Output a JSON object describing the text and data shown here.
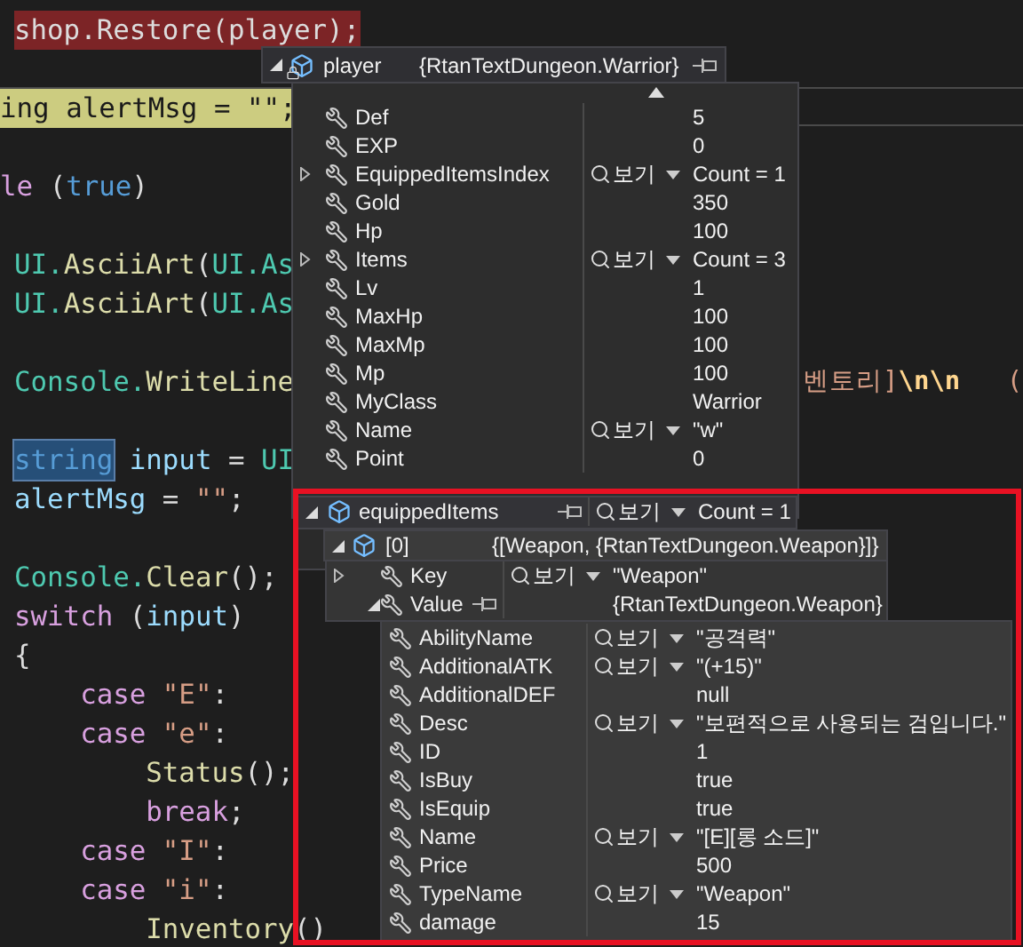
{
  "code_lines": [
    {
      "breakpoint": true,
      "current": false,
      "cut_left": false,
      "tokens": [
        {
          "text": "shop.Restore(player);",
          "kind": "plain"
        }
      ]
    },
    {
      "breakpoint": false,
      "current": false
    },
    {
      "breakpoint": false,
      "current": true,
      "cut_left": true,
      "tokens": [
        {
          "text": "ing alertMsg = \"\";",
          "kind": "plain"
        }
      ]
    },
    {
      "breakpoint": false,
      "current": false
    },
    {
      "breakpoint": false,
      "current": false,
      "cut_left": true,
      "tokens": [
        {
          "text": "le",
          "kind": "control"
        },
        {
          "text": " (",
          "kind": "plain"
        },
        {
          "text": "true",
          "kind": "keyword"
        },
        {
          "text": ")",
          "kind": "plain"
        }
      ]
    },
    {
      "breakpoint": false,
      "current": false
    },
    {
      "breakpoint": false,
      "current": false,
      "cut_left": false,
      "tokens": [
        {
          "text": "UI.",
          "kind": "type"
        },
        {
          "text": "AsciiArt",
          "kind": "method"
        },
        {
          "text": "(",
          "kind": "plain"
        },
        {
          "text": "UI.As",
          "kind": "type"
        }
      ]
    },
    {
      "breakpoint": false,
      "current": false,
      "cut_left": false,
      "tokens": [
        {
          "text": "UI.",
          "kind": "type"
        },
        {
          "text": "AsciiArt",
          "kind": "method"
        },
        {
          "text": "(",
          "kind": "plain"
        },
        {
          "text": "UI.As",
          "kind": "type"
        }
      ]
    },
    {
      "breakpoint": false,
      "current": false
    },
    {
      "breakpoint": false,
      "current": false,
      "cut_left": false,
      "tokens": [
        {
          "text": "Console.",
          "kind": "type"
        },
        {
          "text": "WriteLine",
          "kind": "method"
        }
      ],
      "far_tokens": [
        {
          "text": "벤토리]",
          "kind": "string"
        },
        {
          "text": "\\n\\n",
          "kind": "escape"
        },
        {
          "text": "   (",
          "kind": "string"
        }
      ]
    },
    {
      "breakpoint": false,
      "current": false
    },
    {
      "breakpoint": false,
      "current": false,
      "cut_left": false,
      "tokens": [
        {
          "text": "string",
          "kind": "selection"
        },
        {
          "text": " input",
          "kind": "variable"
        },
        {
          "text": " = ",
          "kind": "plain"
        },
        {
          "text": "UI",
          "kind": "type"
        }
      ]
    },
    {
      "breakpoint": false,
      "current": false,
      "cut_left": false,
      "tokens": [
        {
          "text": "alertMsg",
          "kind": "variable"
        },
        {
          "text": " = ",
          "kind": "plain"
        },
        {
          "text": "\"\"",
          "kind": "string"
        },
        {
          "text": ";",
          "kind": "plain"
        }
      ]
    },
    {
      "breakpoint": false,
      "current": false
    },
    {
      "breakpoint": false,
      "current": false,
      "cut_left": false,
      "tokens": [
        {
          "text": "Console.",
          "kind": "type"
        },
        {
          "text": "Clear",
          "kind": "method"
        },
        {
          "text": "();",
          "kind": "plain"
        }
      ]
    },
    {
      "breakpoint": false,
      "current": false,
      "cut_left": false,
      "tokens": [
        {
          "text": "switch",
          "kind": "control"
        },
        {
          "text": " (",
          "kind": "plain"
        },
        {
          "text": "input",
          "kind": "variable"
        },
        {
          "text": ")",
          "kind": "plain"
        }
      ]
    },
    {
      "breakpoint": false,
      "current": false,
      "cut_left": false,
      "tokens": [
        {
          "text": "{",
          "kind": "plain"
        }
      ]
    },
    {
      "breakpoint": false,
      "current": false,
      "cut_left": false,
      "tokens": [
        {
          "text": "    case",
          "kind": "control"
        },
        {
          "text": " \"E\"",
          "kind": "string"
        },
        {
          "text": ":",
          "kind": "plain"
        }
      ]
    },
    {
      "breakpoint": false,
      "current": false,
      "cut_left": false,
      "tokens": [
        {
          "text": "    case",
          "kind": "control"
        },
        {
          "text": " \"e\"",
          "kind": "string"
        },
        {
          "text": ":",
          "kind": "plain"
        }
      ]
    },
    {
      "breakpoint": false,
      "current": false,
      "cut_left": false,
      "tokens": [
        {
          "text": "        Status",
          "kind": "method"
        },
        {
          "text": "();",
          "kind": "plain"
        }
      ]
    },
    {
      "breakpoint": false,
      "current": false,
      "cut_left": false,
      "tokens": [
        {
          "text": "        break",
          "kind": "control"
        },
        {
          "text": ";",
          "kind": "plain"
        }
      ]
    },
    {
      "breakpoint": false,
      "current": false,
      "cut_left": false,
      "tokens": [
        {
          "text": "    case",
          "kind": "control"
        },
        {
          "text": " \"I\"",
          "kind": "string"
        },
        {
          "text": ":",
          "kind": "plain"
        }
      ]
    },
    {
      "breakpoint": false,
      "current": false,
      "cut_left": false,
      "tokens": [
        {
          "text": "    case",
          "kind": "control"
        },
        {
          "text": " \"i\"",
          "kind": "string"
        },
        {
          "text": ":",
          "kind": "plain"
        }
      ]
    },
    {
      "breakpoint": false,
      "current": false,
      "cut_left": false,
      "tokens": [
        {
          "text": "        Inventory",
          "kind": "method"
        },
        {
          "text": "()",
          "kind": "plain"
        }
      ]
    }
  ],
  "player_tip": {
    "name": "player",
    "value": "{RtanTextDungeon.Warrior}",
    "expanded": true,
    "locked": true,
    "pin": true,
    "members": [
      {
        "name": "Def",
        "value": "5",
        "expandable": false
      },
      {
        "name": "EXP",
        "value": "0",
        "expandable": false
      },
      {
        "name": "EquippedItemsIndex",
        "view": "보기",
        "value": "Count = 1",
        "expandable": true
      },
      {
        "name": "Gold",
        "value": "350",
        "expandable": false
      },
      {
        "name": "Hp",
        "value": "100",
        "expandable": false
      },
      {
        "name": "Items",
        "view": "보기",
        "value": "Count = 3",
        "expandable": true
      },
      {
        "name": "Lv",
        "value": "1",
        "expandable": false
      },
      {
        "name": "MaxHp",
        "value": "100",
        "expandable": false
      },
      {
        "name": "MaxMp",
        "value": "100",
        "expandable": false
      },
      {
        "name": "Mp",
        "value": "100",
        "expandable": false
      },
      {
        "name": "MyClass",
        "value": "Warrior",
        "expandable": false
      },
      {
        "name": "Name",
        "view": "보기",
        "value": "\"w\"",
        "expandable": false
      },
      {
        "name": "Point",
        "value": "0",
        "expandable": false
      }
    ]
  },
  "equipped_tip": {
    "name": "equippedItems",
    "view": "보기",
    "value": "Count = 1",
    "expanded": true,
    "pin": true,
    "children": [
      {
        "name": "[0]",
        "value": "{[Weapon, {RtanTextDungeon.Weapon}]}",
        "expanded": true,
        "children": [
          {
            "name": "Key",
            "view": "보기",
            "value": "\"Weapon\"",
            "expanded": false,
            "pin": false
          },
          {
            "name": "Value",
            "value": "{RtanTextDungeon.Weapon}",
            "expanded": true,
            "pin": true,
            "children": [
              {
                "name": "AbilityName",
                "view": "보기",
                "value": "\"공격력\""
              },
              {
                "name": "AdditionalATK",
                "view": "보기",
                "value": "\"(+15)\""
              },
              {
                "name": "AdditionalDEF",
                "value": "null"
              },
              {
                "name": "Desc",
                "view": "보기",
                "value": "\"보편적으로 사용되는 검입니다.\""
              },
              {
                "name": "ID",
                "value": "1"
              },
              {
                "name": "IsBuy",
                "value": "true"
              },
              {
                "name": "IsEquip",
                "value": "true"
              },
              {
                "name": "Name",
                "view": "보기",
                "value": "\"[E][롱 소드]\""
              },
              {
                "name": "Price",
                "value": "500"
              },
              {
                "name": "TypeName",
                "view": "보기",
                "value": "\"Weapon\""
              },
              {
                "name": "damage",
                "value": "15"
              }
            ]
          }
        ]
      }
    ]
  },
  "highlight_frame": {
    "shown": true
  }
}
